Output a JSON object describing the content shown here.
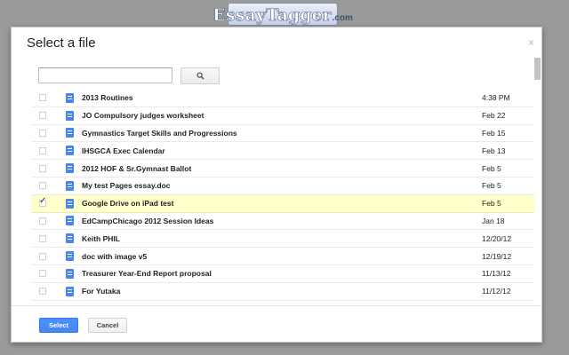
{
  "logo": {
    "part1": "Essay",
    "part2": "Tagger",
    "part3": ".com"
  },
  "dialog": {
    "title": "Select a file",
    "close_glyph": "×"
  },
  "search": {
    "value": "",
    "placeholder": "",
    "button_icon": "search-icon"
  },
  "files": [
    {
      "name": "2013 Routines",
      "date": "4:38 PM",
      "selected": false
    },
    {
      "name": "JO Compulsory judges worksheet",
      "date": "Feb 22",
      "selected": false
    },
    {
      "name": "Gymnastics Target Skills and Progressions",
      "date": "Feb 15",
      "selected": false
    },
    {
      "name": "IHSGCA Exec Calendar",
      "date": "Feb 13",
      "selected": false
    },
    {
      "name": "2012 HOF & Sr.Gymnast Ballot",
      "date": "Feb 5",
      "selected": false
    },
    {
      "name": "My test Pages essay.doc",
      "date": "Feb 5",
      "selected": false
    },
    {
      "name": "Google Drive on iPad test",
      "date": "Feb 5",
      "selected": true
    },
    {
      "name": "EdCampChicago 2012 Session Ideas",
      "date": "Jan 18",
      "selected": false
    },
    {
      "name": "Keith PHIL",
      "date": "12/20/12",
      "selected": false
    },
    {
      "name": "doc with image v5",
      "date": "12/19/12",
      "selected": false
    },
    {
      "name": "Treasurer Year-End Report proposal",
      "date": "11/13/12",
      "selected": false
    },
    {
      "name": "For Yutaka",
      "date": "11/12/12",
      "selected": false
    }
  ],
  "footer": {
    "select_label": "Select",
    "cancel_label": "Cancel"
  },
  "colors": {
    "accent": "#4d90fe",
    "selected_row": "#ffffcc",
    "doc_icon": "#4a86e8"
  }
}
